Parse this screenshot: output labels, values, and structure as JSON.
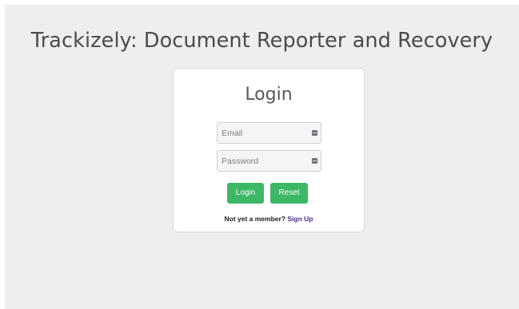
{
  "header": {
    "title": "Trackizely: Document Reporter and Recovery"
  },
  "login": {
    "heading": "Login",
    "email_placeholder": "Email",
    "password_placeholder": "Password",
    "login_button": "Login",
    "reset_button": "Reset",
    "member_prompt": "Not yet a member?",
    "signup_link": "Sign Up"
  },
  "icons": {
    "email_field_icon": "key-icon",
    "password_field_icon": "key-icon"
  },
  "colors": {
    "background": "#edeef0",
    "button": "#3cb866",
    "link": "#4a2a8a"
  }
}
